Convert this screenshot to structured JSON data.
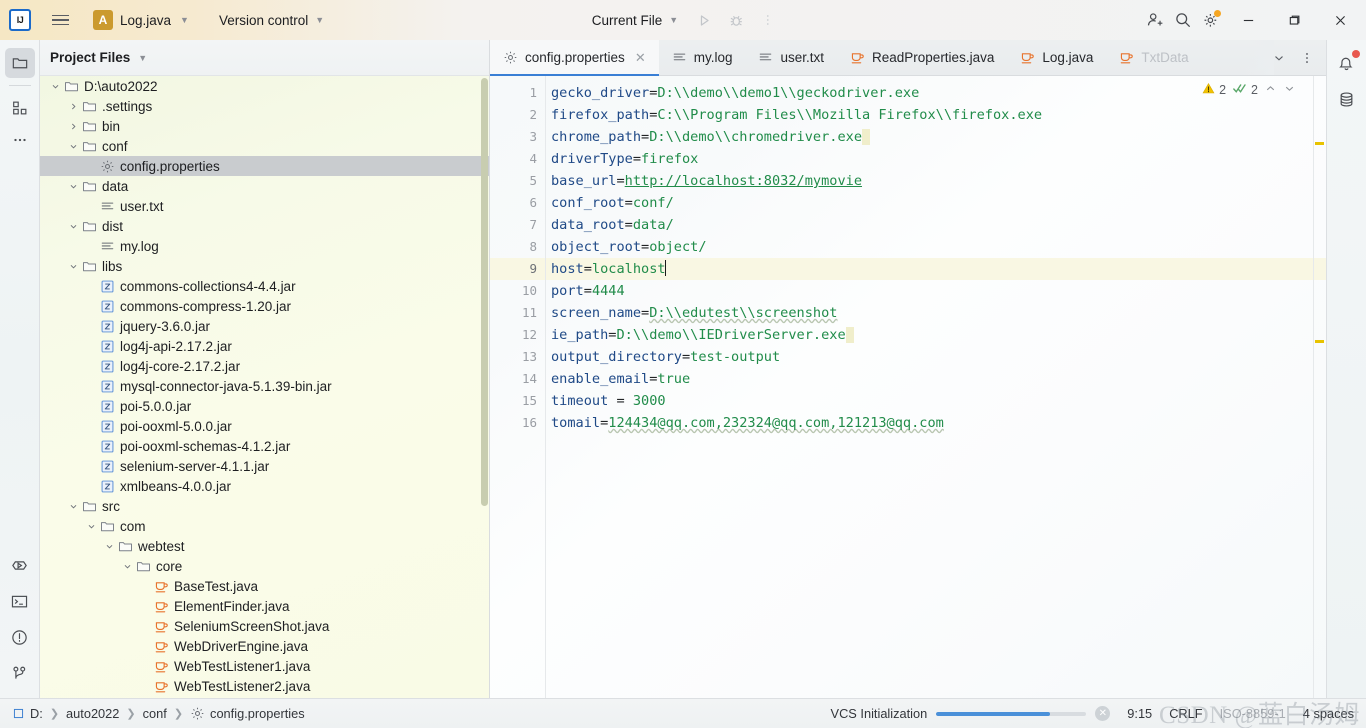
{
  "titlebar": {
    "logo": "IJ",
    "project_badge": "A",
    "project_name": "Log.java",
    "version_control": "Version control",
    "run_config": "Current File",
    "icons": [
      "run-icon",
      "debug-icon",
      "more-actions-icon",
      "add-collaborator-icon",
      "search-icon",
      "settings-gear-icon"
    ],
    "window_minimize": "—",
    "window_maximize": "❐",
    "window_close": "✕"
  },
  "project_panel": {
    "header": "Project Files",
    "tree": [
      {
        "label": "D:\\auto2022",
        "depth": 0,
        "arrow": "down",
        "icon": "folder-icon"
      },
      {
        "label": ".settings",
        "depth": 1,
        "arrow": "right",
        "icon": "folder-icon"
      },
      {
        "label": "bin",
        "depth": 1,
        "arrow": "right",
        "icon": "folder-icon"
      },
      {
        "label": "conf",
        "depth": 1,
        "arrow": "down",
        "icon": "folder-icon"
      },
      {
        "label": "config.properties",
        "depth": 2,
        "arrow": "none",
        "icon": "properties-icon",
        "selected": true
      },
      {
        "label": "data",
        "depth": 1,
        "arrow": "down",
        "icon": "folder-icon"
      },
      {
        "label": "user.txt",
        "depth": 2,
        "arrow": "none",
        "icon": "text-file-icon"
      },
      {
        "label": "dist",
        "depth": 1,
        "arrow": "down",
        "icon": "folder-icon"
      },
      {
        "label": "my.log",
        "depth": 2,
        "arrow": "none",
        "icon": "text-file-icon"
      },
      {
        "label": "libs",
        "depth": 1,
        "arrow": "down",
        "icon": "folder-icon"
      },
      {
        "label": "commons-collections4-4.4.jar",
        "depth": 2,
        "arrow": "none",
        "icon": "jar-icon"
      },
      {
        "label": "commons-compress-1.20.jar",
        "depth": 2,
        "arrow": "none",
        "icon": "jar-icon"
      },
      {
        "label": "jquery-3.6.0.jar",
        "depth": 2,
        "arrow": "none",
        "icon": "jar-icon"
      },
      {
        "label": "log4j-api-2.17.2.jar",
        "depth": 2,
        "arrow": "none",
        "icon": "jar-icon"
      },
      {
        "label": "log4j-core-2.17.2.jar",
        "depth": 2,
        "arrow": "none",
        "icon": "jar-icon"
      },
      {
        "label": "mysql-connector-java-5.1.39-bin.jar",
        "depth": 2,
        "arrow": "none",
        "icon": "jar-icon"
      },
      {
        "label": "poi-5.0.0.jar",
        "depth": 2,
        "arrow": "none",
        "icon": "jar-icon"
      },
      {
        "label": "poi-ooxml-5.0.0.jar",
        "depth": 2,
        "arrow": "none",
        "icon": "jar-icon"
      },
      {
        "label": "poi-ooxml-schemas-4.1.2.jar",
        "depth": 2,
        "arrow": "none",
        "icon": "jar-icon"
      },
      {
        "label": "selenium-server-4.1.1.jar",
        "depth": 2,
        "arrow": "none",
        "icon": "jar-icon"
      },
      {
        "label": "xmlbeans-4.0.0.jar",
        "depth": 2,
        "arrow": "none",
        "icon": "jar-icon"
      },
      {
        "label": "src",
        "depth": 1,
        "arrow": "down",
        "icon": "folder-icon"
      },
      {
        "label": "com",
        "depth": 2,
        "arrow": "down",
        "icon": "folder-icon"
      },
      {
        "label": "webtest",
        "depth": 3,
        "arrow": "down",
        "icon": "folder-icon"
      },
      {
        "label": "core",
        "depth": 4,
        "arrow": "down",
        "icon": "folder-icon"
      },
      {
        "label": "BaseTest.java",
        "depth": 5,
        "arrow": "none",
        "icon": "java-icon"
      },
      {
        "label": "ElementFinder.java",
        "depth": 5,
        "arrow": "none",
        "icon": "java-icon"
      },
      {
        "label": "SeleniumScreenShot.java",
        "depth": 5,
        "arrow": "none",
        "icon": "java-icon"
      },
      {
        "label": "WebDriverEngine.java",
        "depth": 5,
        "arrow": "none",
        "icon": "java-icon"
      },
      {
        "label": "WebTestListener1.java",
        "depth": 5,
        "arrow": "none",
        "icon": "java-icon"
      },
      {
        "label": "WebTestListener2.java",
        "depth": 5,
        "arrow": "none",
        "icon": "java-icon"
      }
    ]
  },
  "tabs": [
    {
      "label": "config.properties",
      "icon": "properties-icon",
      "active": true,
      "closable": true
    },
    {
      "label": "my.log",
      "icon": "text-file-icon",
      "active": false
    },
    {
      "label": "user.txt",
      "icon": "text-file-icon",
      "active": false
    },
    {
      "label": "ReadProperties.java",
      "icon": "java-icon",
      "active": false
    },
    {
      "label": "Log.java",
      "icon": "java-icon",
      "active": false
    },
    {
      "label": "TxtData",
      "icon": "java-icon",
      "active": false,
      "faded": true
    }
  ],
  "editor": {
    "inspection": {
      "warning_count": "2",
      "ok_count": "2"
    },
    "current_line": 9,
    "lines": [
      {
        "n": 1,
        "key": "gecko_driver",
        "eq": "=",
        "value": "D:\\\\demo\\\\demo1\\\\geckodriver.exe"
      },
      {
        "n": 2,
        "key": "firefox_path",
        "eq": "=",
        "value": "C:\\\\Program Files\\\\Mozilla Firefox\\\\firefox.exe"
      },
      {
        "n": 3,
        "key": "chrome_path",
        "eq": "=",
        "value": "D:\\\\demo\\\\chromedriver.exe",
        "trailing_highlight": true
      },
      {
        "n": 4,
        "key": "driverType",
        "eq": "=",
        "value": "firefox"
      },
      {
        "n": 5,
        "key": "base_url",
        "eq": "=",
        "value": "http://localhost:8032/mymovie",
        "link": true
      },
      {
        "n": 6,
        "key": "conf_root",
        "eq": "=",
        "value": "conf/"
      },
      {
        "n": 7,
        "key": "data_root",
        "eq": "=",
        "value": "data/"
      },
      {
        "n": 8,
        "key": "object_root",
        "eq": "=",
        "value": "object/"
      },
      {
        "n": 9,
        "key": "host",
        "eq": "=",
        "value": "localhost",
        "caret": true
      },
      {
        "n": 10,
        "key": "port",
        "eq": "=",
        "value": "4444"
      },
      {
        "n": 11,
        "key": "screen_name",
        "eq": "=",
        "value": "D:\\\\edutest\\\\screenshot",
        "squiggle": true
      },
      {
        "n": 12,
        "key": "ie_path",
        "eq": "=",
        "value": "D:\\\\demo\\\\IEDriverServer.exe",
        "trailing_highlight": true
      },
      {
        "n": 13,
        "key": "output_directory",
        "eq": "=",
        "value": "test-output"
      },
      {
        "n": 14,
        "key": "enable_email",
        "eq": "=",
        "value": "true"
      },
      {
        "n": 15,
        "key": "timeout ",
        "eq": "= ",
        "value": "3000"
      },
      {
        "n": 16,
        "key": "tomail",
        "eq": "=",
        "value": "124434@qq.com,232324@qq.com,121213@qq.com",
        "squiggle": true
      }
    ]
  },
  "right_rail": {
    "icons": [
      "notifications-bell-icon",
      "database-icon"
    ]
  },
  "left_rail": {
    "top_icons": [
      "project-folder-icon",
      "structure-icon",
      "more-tool-windows-icon"
    ],
    "bottom_icons": [
      "run-tool-icon",
      "terminal-icon",
      "problems-icon",
      "git-branch-icon"
    ]
  },
  "status_bar": {
    "breadcrumbs": [
      {
        "label": "D:",
        "icon": "drive-icon"
      },
      {
        "label": "auto2022"
      },
      {
        "label": "conf"
      },
      {
        "label": "config.properties",
        "icon": "properties-icon"
      }
    ],
    "vcs_task": "VCS Initialization",
    "progress_percent": 76,
    "caret_position": "9:15",
    "line_separator": "CRLF",
    "encoding": "ISO-8859-1",
    "indent": "4 spaces",
    "watermark": "CSDN @蓝白汤姆"
  },
  "colors": {
    "accent": "#3a7fd5",
    "key": "#204a87",
    "value": "#218c4a",
    "warning": "#e8c300",
    "java_icon": "#e8732c",
    "sidebar_bg": "#f8fbe8"
  }
}
